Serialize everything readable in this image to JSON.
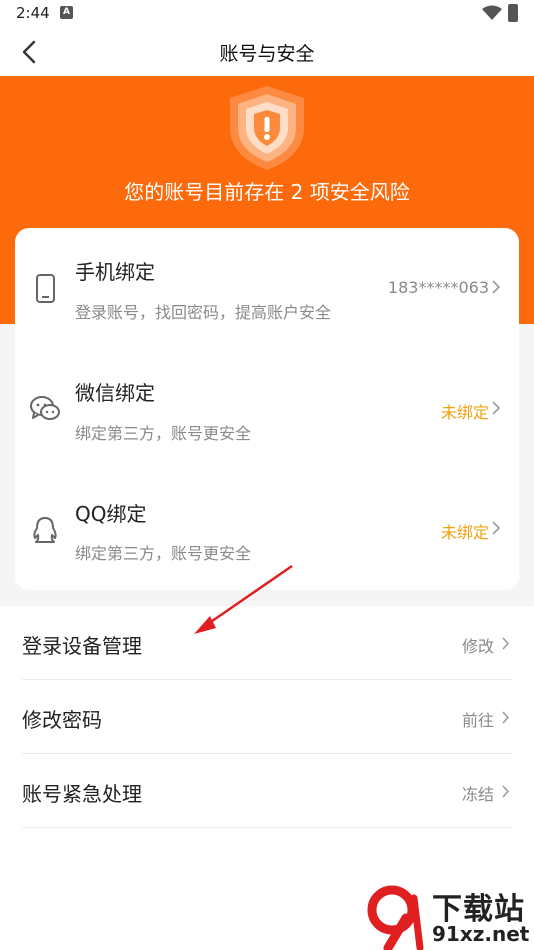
{
  "status_bar": {
    "time": "2:44",
    "notif": "A"
  },
  "nav": {
    "title": "账号与安全"
  },
  "hero": {
    "risk_text": "您的账号目前存在 2 项安全风险"
  },
  "bindings": [
    {
      "title": "手机绑定",
      "desc": "登录账号，找回密码，提高账户安全",
      "value": "183*****063",
      "value_color": "#8a8a8a",
      "icon": "phone-icon"
    },
    {
      "title": "微信绑定",
      "desc": "绑定第三方，账号更安全",
      "value": "未绑定",
      "value_color": "#f2a10c",
      "icon": "wechat-icon"
    },
    {
      "title": "QQ绑定",
      "desc": "绑定第三方，账号更安全",
      "value": "未绑定",
      "value_color": "#f2a10c",
      "icon": "qq-icon"
    }
  ],
  "settings": [
    {
      "label": "登录设备管理",
      "value": "修改"
    },
    {
      "label": "修改密码",
      "value": "前往"
    },
    {
      "label": "账号紧急处理",
      "value": "冻结"
    }
  ],
  "watermark": {
    "title": "下载站",
    "url": "91xz.net"
  },
  "colors": {
    "brand": "#fd6a0b",
    "unbound": "#f2a10c"
  }
}
